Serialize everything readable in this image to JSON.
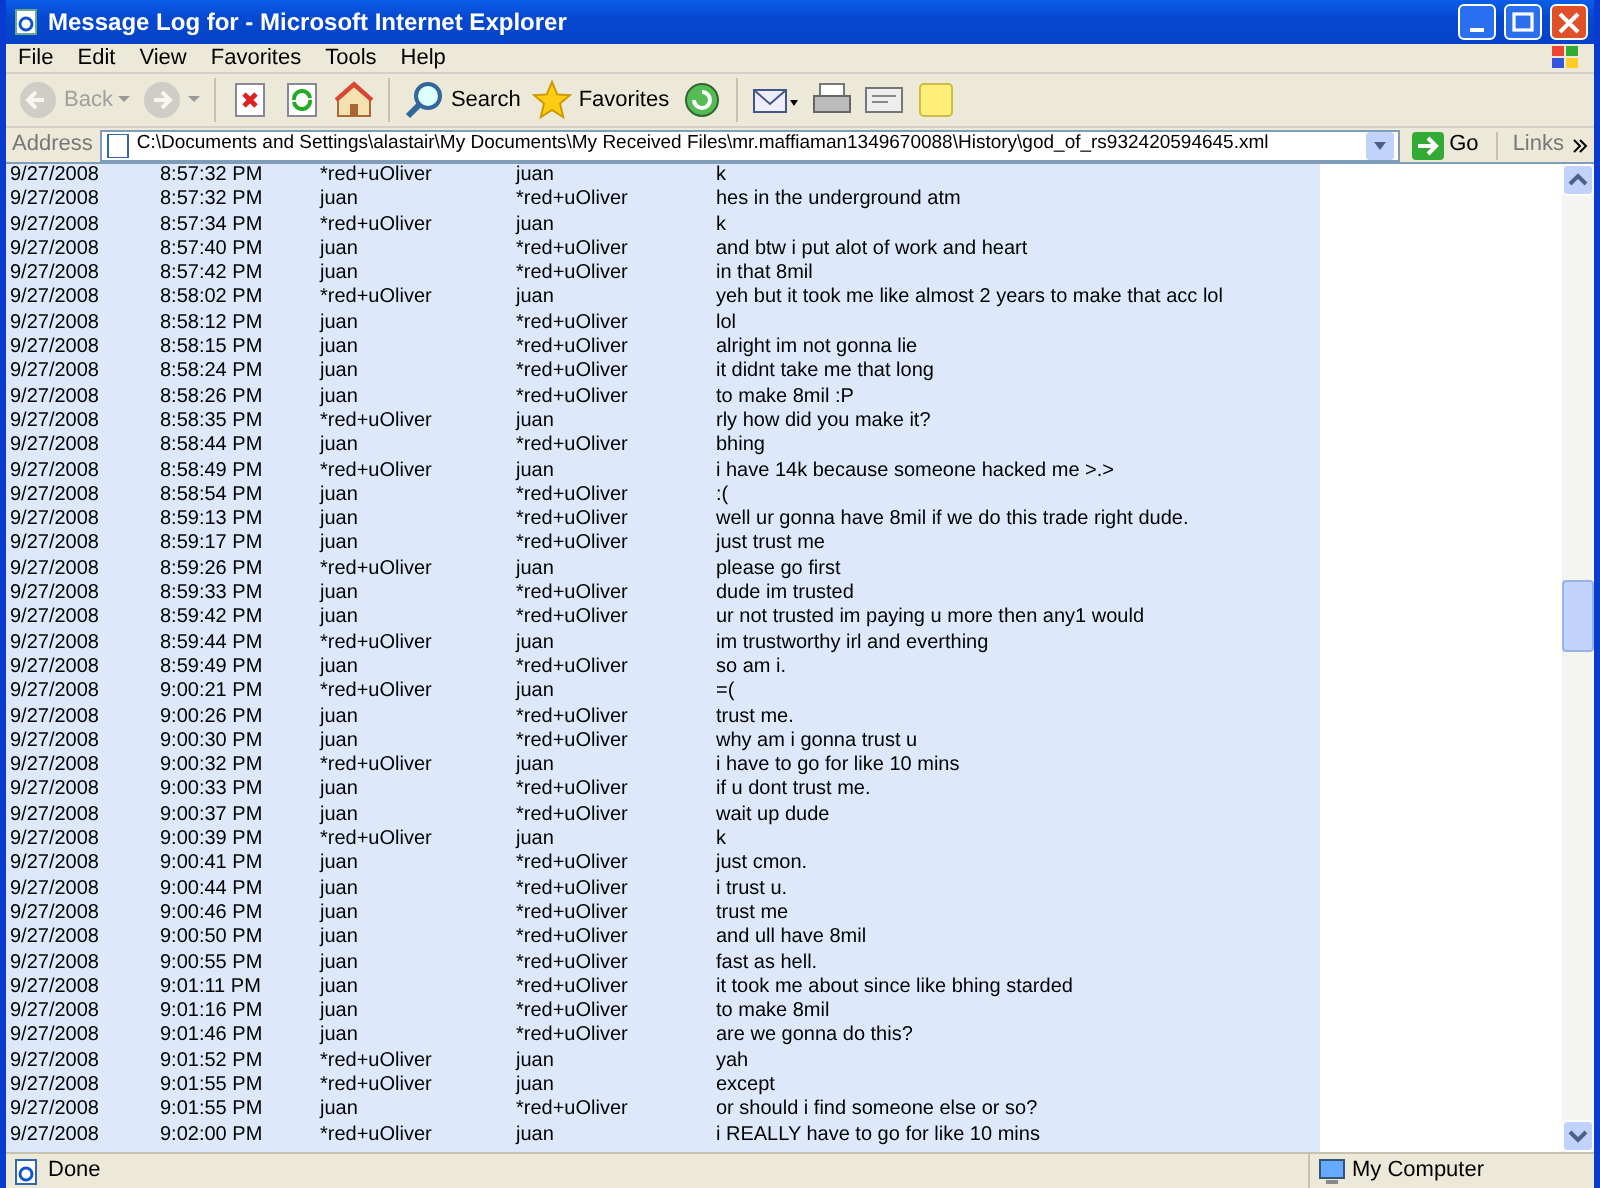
{
  "window": {
    "title": "Message Log for - Microsoft Internet Explorer"
  },
  "menu": [
    "File",
    "Edit",
    "View",
    "Favorites",
    "Tools",
    "Help"
  ],
  "toolbar": [
    {
      "kind": "back",
      "label": "Back",
      "disabled": true
    },
    {
      "kind": "forward",
      "disabled": true
    },
    {
      "kind": "stop"
    },
    {
      "kind": "refresh"
    },
    {
      "kind": "home"
    },
    {
      "kind": "search",
      "label": "Search"
    },
    {
      "kind": "favorites",
      "label": "Favorites"
    },
    {
      "kind": "media"
    },
    {
      "kind": "mail"
    },
    {
      "kind": "print"
    },
    {
      "kind": "edit"
    },
    {
      "kind": "note"
    }
  ],
  "address": {
    "label": "Address",
    "value": "C:\\Documents and Settings\\alastair\\My Documents\\My Received Files\\mr.maffiaman1349670088\\History\\god_of_rs932420594645.xml",
    "go": "Go",
    "links": "Links"
  },
  "log": [
    {
      "date": "9/27/2008",
      "time": "8:57:32 PM",
      "from": "*red+uOliver",
      "to": "juan",
      "message": "k"
    },
    {
      "date": "9/27/2008",
      "time": "8:57:32 PM",
      "from": "juan",
      "to": "*red+uOliver",
      "message": "hes in the underground atm"
    },
    {
      "date": "9/27/2008",
      "time": "8:57:34 PM",
      "from": "*red+uOliver",
      "to": "juan",
      "message": "k"
    },
    {
      "date": "9/27/2008",
      "time": "8:57:40 PM",
      "from": "juan",
      "to": "*red+uOliver",
      "message": "and btw i put alot of work and heart"
    },
    {
      "date": "9/27/2008",
      "time": "8:57:42 PM",
      "from": "juan",
      "to": "*red+uOliver",
      "message": "in that 8mil"
    },
    {
      "date": "9/27/2008",
      "time": "8:58:02 PM",
      "from": "*red+uOliver",
      "to": "juan",
      "message": "yeh but it took me like almost 2 years to make that acc lol"
    },
    {
      "date": "9/27/2008",
      "time": "8:58:12 PM",
      "from": "juan",
      "to": "*red+uOliver",
      "message": "lol"
    },
    {
      "date": "9/27/2008",
      "time": "8:58:15 PM",
      "from": "juan",
      "to": "*red+uOliver",
      "message": "alright im not gonna lie"
    },
    {
      "date": "9/27/2008",
      "time": "8:58:24 PM",
      "from": "juan",
      "to": "*red+uOliver",
      "message": "it didnt take me that long"
    },
    {
      "date": "9/27/2008",
      "time": "8:58:26 PM",
      "from": "juan",
      "to": "*red+uOliver",
      "message": "to make 8mil :P"
    },
    {
      "date": "9/27/2008",
      "time": "8:58:35 PM",
      "from": "*red+uOliver",
      "to": "juan",
      "message": "rly how did you make it?"
    },
    {
      "date": "9/27/2008",
      "time": "8:58:44 PM",
      "from": "juan",
      "to": "*red+uOliver",
      "message": "bhing"
    },
    {
      "date": "9/27/2008",
      "time": "8:58:49 PM",
      "from": "*red+uOliver",
      "to": "juan",
      "message": "i have 14k because someone hacked me >.>"
    },
    {
      "date": "9/27/2008",
      "time": "8:58:54 PM",
      "from": "juan",
      "to": "*red+uOliver",
      "message": ":("
    },
    {
      "date": "9/27/2008",
      "time": "8:59:13 PM",
      "from": "juan",
      "to": "*red+uOliver",
      "message": "well ur gonna have 8mil if we do this trade right dude."
    },
    {
      "date": "9/27/2008",
      "time": "8:59:17 PM",
      "from": "juan",
      "to": "*red+uOliver",
      "message": "just trust me"
    },
    {
      "date": "9/27/2008",
      "time": "8:59:26 PM",
      "from": "*red+uOliver",
      "to": "juan",
      "message": "please go first"
    },
    {
      "date": "9/27/2008",
      "time": "8:59:33 PM",
      "from": "juan",
      "to": "*red+uOliver",
      "message": "dude im trusted"
    },
    {
      "date": "9/27/2008",
      "time": "8:59:42 PM",
      "from": "juan",
      "to": "*red+uOliver",
      "message": "ur not trusted im paying u more then any1 would"
    },
    {
      "date": "9/27/2008",
      "time": "8:59:44 PM",
      "from": "*red+uOliver",
      "to": "juan",
      "message": "im trustworthy irl and everthing"
    },
    {
      "date": "9/27/2008",
      "time": "8:59:49 PM",
      "from": "juan",
      "to": "*red+uOliver",
      "message": "so am i."
    },
    {
      "date": "9/27/2008",
      "time": "9:00:21 PM",
      "from": "*red+uOliver",
      "to": "juan",
      "message": "=("
    },
    {
      "date": "9/27/2008",
      "time": "9:00:26 PM",
      "from": "juan",
      "to": "*red+uOliver",
      "message": "trust me."
    },
    {
      "date": "9/27/2008",
      "time": "9:00:30 PM",
      "from": "juan",
      "to": "*red+uOliver",
      "message": "why am i gonna trust u"
    },
    {
      "date": "9/27/2008",
      "time": "9:00:32 PM",
      "from": "*red+uOliver",
      "to": "juan",
      "message": "i have to go for like 10 mins"
    },
    {
      "date": "9/27/2008",
      "time": "9:00:33 PM",
      "from": "juan",
      "to": "*red+uOliver",
      "message": "if u dont trust me."
    },
    {
      "date": "9/27/2008",
      "time": "9:00:37 PM",
      "from": "juan",
      "to": "*red+uOliver",
      "message": "wait up dude"
    },
    {
      "date": "9/27/2008",
      "time": "9:00:39 PM",
      "from": "*red+uOliver",
      "to": "juan",
      "message": "k"
    },
    {
      "date": "9/27/2008",
      "time": "9:00:41 PM",
      "from": "juan",
      "to": "*red+uOliver",
      "message": "just cmon."
    },
    {
      "date": "9/27/2008",
      "time": "9:00:44 PM",
      "from": "juan",
      "to": "*red+uOliver",
      "message": "i trust u."
    },
    {
      "date": "9/27/2008",
      "time": "9:00:46 PM",
      "from": "juan",
      "to": "*red+uOliver",
      "message": "trust me"
    },
    {
      "date": "9/27/2008",
      "time": "9:00:50 PM",
      "from": "juan",
      "to": "*red+uOliver",
      "message": "and ull have 8mil"
    },
    {
      "date": "9/27/2008",
      "time": "9:00:55 PM",
      "from": "juan",
      "to": "*red+uOliver",
      "message": "fast as hell."
    },
    {
      "date": "9/27/2008",
      "time": "9:01:11 PM",
      "from": "juan",
      "to": "*red+uOliver",
      "message": "it took me about since like bhing starded"
    },
    {
      "date": "9/27/2008",
      "time": "9:01:16 PM",
      "from": "juan",
      "to": "*red+uOliver",
      "message": "to make 8mil"
    },
    {
      "date": "9/27/2008",
      "time": "9:01:46 PM",
      "from": "juan",
      "to": "*red+uOliver",
      "message": "are we gonna do this?"
    },
    {
      "date": "9/27/2008",
      "time": "9:01:52 PM",
      "from": "*red+uOliver",
      "to": "juan",
      "message": "yah"
    },
    {
      "date": "9/27/2008",
      "time": "9:01:55 PM",
      "from": "*red+uOliver",
      "to": "juan",
      "message": "except"
    },
    {
      "date": "9/27/2008",
      "time": "9:01:55 PM",
      "from": "juan",
      "to": "*red+uOliver",
      "message": "or should i find someone else or so?"
    },
    {
      "date": "9/27/2008",
      "time": "9:02:00 PM",
      "from": "*red+uOliver",
      "to": "juan",
      "message": "i REALLY have to go for like 10 mins"
    }
  ],
  "status_bar": {
    "text": "Done",
    "zone": "My Computer"
  }
}
